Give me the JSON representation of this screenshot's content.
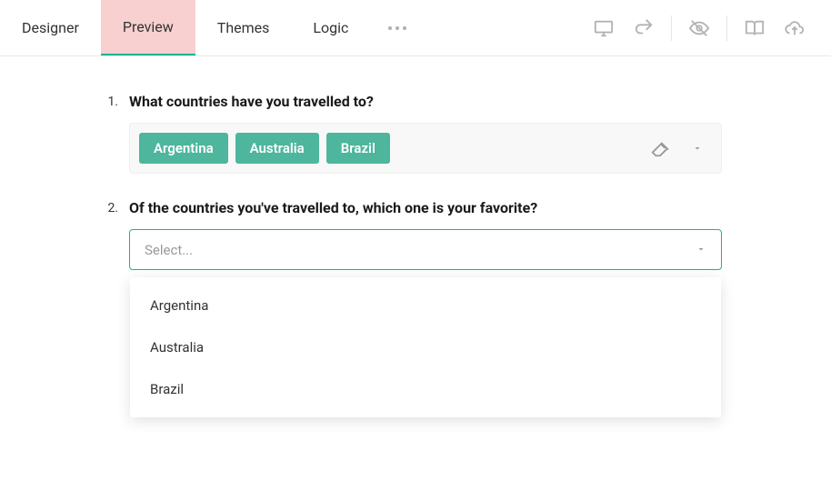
{
  "toolbar": {
    "tabs": [
      {
        "label": "Designer"
      },
      {
        "label": "Preview"
      },
      {
        "label": "Themes"
      },
      {
        "label": "Logic"
      }
    ]
  },
  "questions": {
    "q1": {
      "num": "1.",
      "title": "What countries have you travelled to?",
      "tags": [
        "Argentina",
        "Australia",
        "Brazil"
      ]
    },
    "q2": {
      "num": "2.",
      "title": "Of the countries you've travelled to, which one is your favorite?",
      "placeholder": "Select...",
      "options": [
        "Argentina",
        "Australia",
        "Brazil"
      ]
    }
  }
}
